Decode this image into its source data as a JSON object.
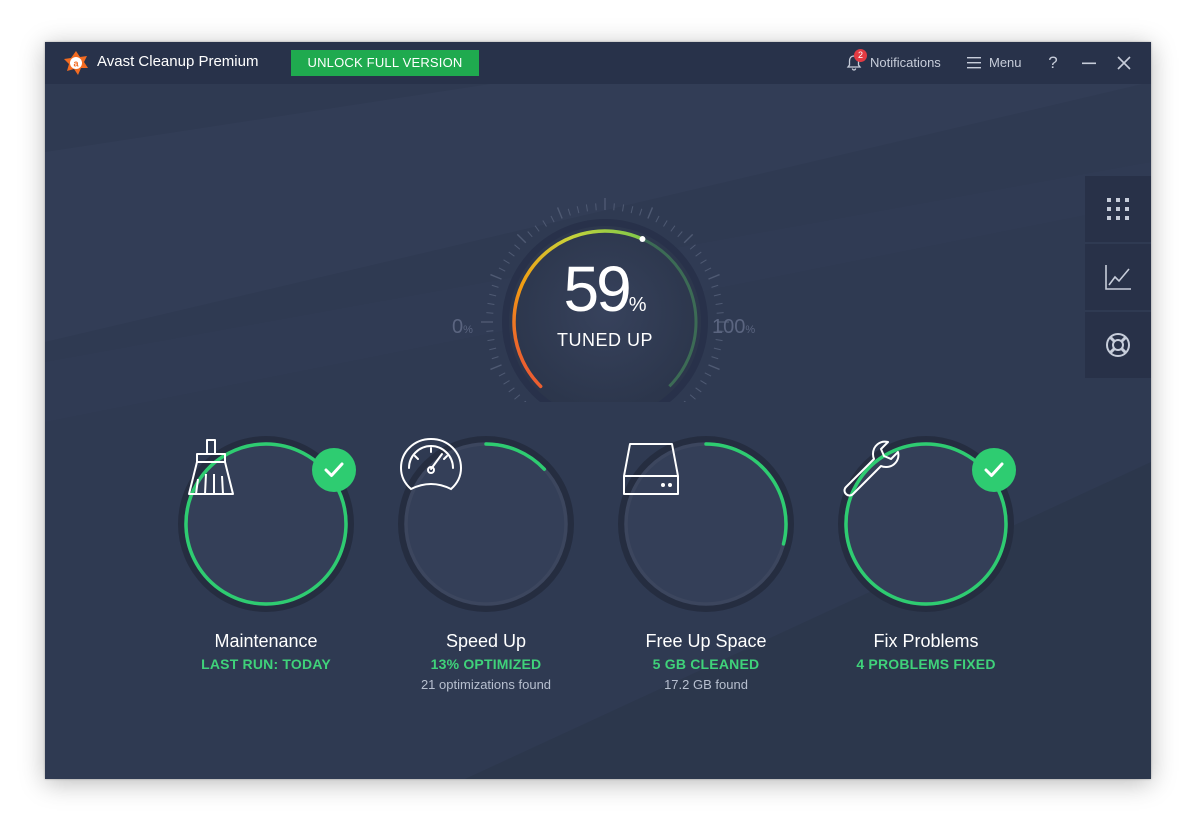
{
  "app": {
    "title": "Avast Cleanup Premium",
    "unlock_label": "UNLOCK FULL VERSION"
  },
  "header": {
    "notifications_label": "Notifications",
    "notifications_count": "2",
    "menu_label": "Menu",
    "help_label": "?"
  },
  "side_panel": {
    "items": [
      {
        "icon": "grid-icon"
      },
      {
        "icon": "chart-icon"
      },
      {
        "icon": "lifebuoy-icon"
      }
    ]
  },
  "gauge": {
    "value": "59",
    "unit": "%",
    "label": "TUNED UP",
    "min": "0",
    "max": "100",
    "fraction": 0.59
  },
  "cards": [
    {
      "title": "Maintenance",
      "status": "LAST RUN: TODAY",
      "detail": "",
      "progress": 1.0,
      "done": true,
      "icon": "broom-icon"
    },
    {
      "title": "Speed Up",
      "status": "13% OPTIMIZED",
      "detail": "21 optimizations found",
      "progress": 0.13,
      "done": false,
      "icon": "speedometer-icon"
    },
    {
      "title": "Free Up Space",
      "status": "5 GB CLEANED",
      "detail": "17.2 GB found",
      "progress": 0.29,
      "done": false,
      "icon": "hard-drive-icon"
    },
    {
      "title": "Fix Problems",
      "status": "4 PROBLEMS FIXED",
      "detail": "",
      "progress": 1.0,
      "done": true,
      "icon": "wrench-icon"
    }
  ],
  "colors": {
    "accent_green": "#2ecc71",
    "brand_orange": "#f26b21",
    "background": "#2f3a52",
    "titlebar": "#28324a"
  }
}
